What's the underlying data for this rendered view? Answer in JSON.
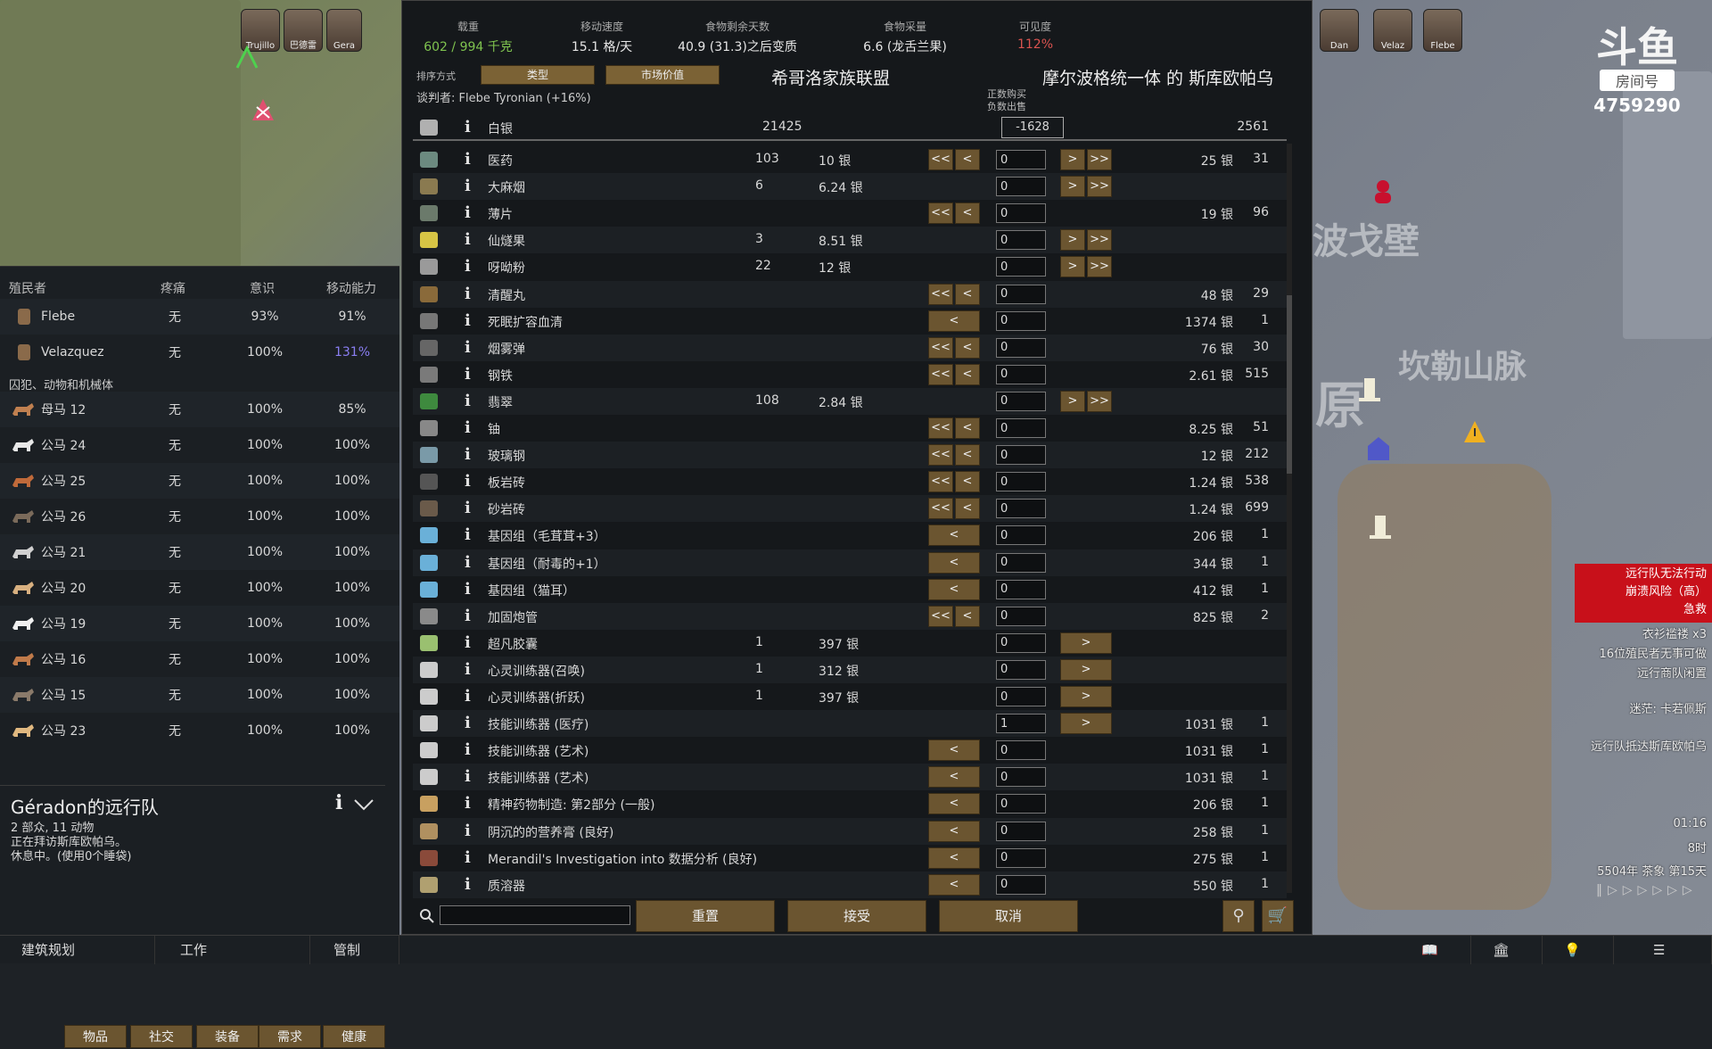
{
  "map": {
    "labels": [
      "波戈壁",
      "坎勒山脉",
      "原"
    ],
    "top_pawns_left": [
      "Trujillo",
      "巴德雷",
      "Gera"
    ],
    "top_pawns_right": [
      "Dan",
      "Velaz",
      "Flebe"
    ],
    "pawn_status": "Z"
  },
  "watermark": {
    "title": "斗鱼",
    "subtitle": "房间号",
    "room": "4759290"
  },
  "trade": {
    "stats": [
      {
        "label": "载重",
        "value": "602 / 994 千克",
        "color": "#7fc34f"
      },
      {
        "label": "移动速度",
        "value": "15.1 格/天",
        "color": "#e6e6e6"
      },
      {
        "label": "食物剩余天数",
        "value": "40.9 (31.3)之后变质",
        "color": "#e6e6e6"
      },
      {
        "label": "食物采量",
        "value": "6.6 (龙舌兰果)",
        "color": "#e6e6e6"
      },
      {
        "label": "可见度",
        "value": "112%",
        "color": "#d9534f"
      }
    ],
    "sort_label": "排序方式",
    "sort_btn1": "类型",
    "sort_btn2": "市场价值",
    "left_faction": "希哥洛家族联盟",
    "negotiator": "谈判者: Flebe Tyronian (+16%)",
    "right_faction": "摩尔波格统一体 的 斯库欧帕乌",
    "buy_sell_hint1": "正数购买",
    "buy_sell_hint2": "负数出售",
    "silver": {
      "name": "白银",
      "qty": "21425",
      "delta": "-1628",
      "trader_qty": "2561"
    },
    "rows": [
      {
        "icon": "#6c8a80",
        "name": "医药",
        "qty": "103",
        "price": "10 银",
        "sell": "25 银",
        "sqty": "31",
        "ll": true,
        "rr": true,
        "val": "0"
      },
      {
        "icon": "#8a7a50",
        "name": "大麻烟",
        "qty": "6",
        "price": "6.24 银",
        "sell": "",
        "sqty": "",
        "ll": false,
        "rr": true,
        "val": "0"
      },
      {
        "icon": "#6b7a6b",
        "name": "薄片",
        "qty": "",
        "price": "",
        "sell": "19 银",
        "sqty": "96",
        "ll": true,
        "rr": false,
        "val": "0"
      },
      {
        "icon": "#d6c445",
        "name": "仙燧果",
        "qty": "3",
        "price": "8.51 银",
        "sell": "",
        "sqty": "",
        "ll": false,
        "rr": true,
        "val": "0"
      },
      {
        "icon": "#9a9a9a",
        "name": "呀呦粉",
        "qty": "22",
        "price": "12 银",
        "sell": "",
        "sqty": "",
        "ll": false,
        "rr": true,
        "val": "0"
      },
      {
        "icon": "#8a6a3a",
        "name": "清醒丸",
        "qty": "",
        "price": "",
        "sell": "48 银",
        "sqty": "29",
        "ll": true,
        "rr": false,
        "val": "0"
      },
      {
        "icon": "#777777",
        "name": "死眠扩容血清",
        "qty": "",
        "price": "",
        "sell": "1374 银",
        "sqty": "1",
        "ll": "single",
        "rr": false,
        "val": "0"
      },
      {
        "icon": "#666666",
        "name": "烟雾弹",
        "qty": "",
        "price": "",
        "sell": "76 银",
        "sqty": "30",
        "ll": true,
        "rr": false,
        "val": "0"
      },
      {
        "icon": "#7a7a7a",
        "name": "钢铁",
        "qty": "",
        "price": "",
        "sell": "2.61 银",
        "sqty": "515",
        "ll": true,
        "rr": false,
        "val": "0"
      },
      {
        "icon": "#3e8a3e",
        "name": "翡翠",
        "qty": "108",
        "price": "2.84 银",
        "sell": "",
        "sqty": "",
        "ll": false,
        "rr": true,
        "val": "0"
      },
      {
        "icon": "#888888",
        "name": "铀",
        "qty": "",
        "price": "",
        "sell": "8.25 银",
        "sqty": "51",
        "ll": true,
        "rr": false,
        "val": "0"
      },
      {
        "icon": "#7a9aa8",
        "name": "玻璃钢",
        "qty": "",
        "price": "",
        "sell": "12 银",
        "sqty": "212",
        "ll": true,
        "rr": false,
        "val": "0"
      },
      {
        "icon": "#555555",
        "name": "板岩砖",
        "qty": "",
        "price": "",
        "sell": "1.24 银",
        "sqty": "538",
        "ll": true,
        "rr": false,
        "val": "0"
      },
      {
        "icon": "#6a5a4a",
        "name": "砂岩砖",
        "qty": "",
        "price": "",
        "sell": "1.24 银",
        "sqty": "699",
        "ll": true,
        "rr": false,
        "val": "0"
      },
      {
        "icon": "#6ab0d8",
        "name": "基因组（毛茸茸+3）",
        "qty": "",
        "price": "",
        "sell": "206 银",
        "sqty": "1",
        "ll": "single",
        "rr": false,
        "val": "0"
      },
      {
        "icon": "#6ab0d8",
        "name": "基因组（耐毒的+1）",
        "qty": "",
        "price": "",
        "sell": "344 银",
        "sqty": "1",
        "ll": "single",
        "rr": false,
        "val": "0"
      },
      {
        "icon": "#6ab0d8",
        "name": "基因组（猫耳）",
        "qty": "",
        "price": "",
        "sell": "412 银",
        "sqty": "1",
        "ll": "single",
        "rr": false,
        "val": "0"
      },
      {
        "icon": "#8a8a8a",
        "name": "加固炮管",
        "qty": "",
        "price": "",
        "sell": "825 银",
        "sqty": "2",
        "ll": true,
        "rr": false,
        "val": "0"
      },
      {
        "icon": "#9ac070",
        "name": "超凡胶囊",
        "qty": "1",
        "price": "397 银",
        "sell": "",
        "sqty": "",
        "ll": false,
        "rr": "single",
        "val": "0"
      },
      {
        "icon": "#cccccc",
        "name": "心灵训练器(召唤)",
        "qty": "1",
        "price": "312 银",
        "sell": "",
        "sqty": "",
        "ll": false,
        "rr": "single",
        "val": "0"
      },
      {
        "icon": "#cccccc",
        "name": "心灵训练器(折跃)",
        "qty": "1",
        "price": "397 银",
        "sell": "",
        "sqty": "",
        "ll": false,
        "rr": "single",
        "val": "0"
      },
      {
        "icon": "#cccccc",
        "name": "技能训练器 (医疗)",
        "qty": "",
        "price": "",
        "sell": "1031 银",
        "sqty": "1",
        "ll": false,
        "rr": "single",
        "val": "1"
      },
      {
        "icon": "#cccccc",
        "name": "技能训练器 (艺术)",
        "qty": "",
        "price": "",
        "sell": "1031 银",
        "sqty": "1",
        "ll": "single",
        "rr": false,
        "val": "0"
      },
      {
        "icon": "#cccccc",
        "name": "技能训练器 (艺术)",
        "qty": "",
        "price": "",
        "sell": "1031 银",
        "sqty": "1",
        "ll": "single",
        "rr": false,
        "val": "0"
      },
      {
        "icon": "#c8a060",
        "name": "精神药物制造: 第2部分 (一般)",
        "qty": "",
        "price": "",
        "sell": "206 银",
        "sqty": "1",
        "ll": "single",
        "rr": false,
        "val": "0"
      },
      {
        "icon": "#b09060",
        "name": "阴沉的的营养膏 (良好)",
        "qty": "",
        "price": "",
        "sell": "258 银",
        "sqty": "1",
        "ll": "single",
        "rr": false,
        "val": "0"
      },
      {
        "icon": "#8a4a3a",
        "name": "Merandil's Investigation into 数据分析 (良好)",
        "qty": "",
        "price": "",
        "sell": "275 银",
        "sqty": "1",
        "ll": "single",
        "rr": false,
        "val": "0"
      },
      {
        "icon": "#b0a070",
        "name": "质溶器",
        "qty": "",
        "price": "",
        "sell": "550 银",
        "sqty": "1",
        "ll": "single",
        "rr": false,
        "val": "0"
      }
    ],
    "search_placeholder": "",
    "btn_reset": "重置",
    "btn_accept": "接受",
    "btn_cancel": "取消"
  },
  "left_panel": {
    "headers": [
      "殖民者",
      "疼痛",
      "意识",
      "移动能力"
    ],
    "colonists": [
      {
        "name": "Flebe",
        "pain": "无",
        "cons": "93%",
        "move": "91%",
        "move_color": "#d8d8d8"
      },
      {
        "name": "Velazquez",
        "pain": "无",
        "cons": "100%",
        "move": "131%",
        "move_color": "#8a7ef2"
      }
    ],
    "section": "囚犯、动物和机械体",
    "animals": [
      {
        "name": "母马 12",
        "pain": "无",
        "cons": "100%",
        "move": "85%",
        "color": "#c08050"
      },
      {
        "name": "公马 24",
        "pain": "无",
        "cons": "100%",
        "move": "100%",
        "color": "#e8e8e8"
      },
      {
        "name": "公马 25",
        "pain": "无",
        "cons": "100%",
        "move": "100%",
        "color": "#c06a3a"
      },
      {
        "name": "公马 26",
        "pain": "无",
        "cons": "100%",
        "move": "100%",
        "color": "#7a6a5a"
      },
      {
        "name": "公马 21",
        "pain": "无",
        "cons": "100%",
        "move": "100%",
        "color": "#d0d0d0"
      },
      {
        "name": "公马 20",
        "pain": "无",
        "cons": "100%",
        "move": "100%",
        "color": "#d8b080"
      },
      {
        "name": "公马 19",
        "pain": "无",
        "cons": "100%",
        "move": "100%",
        "color": "#f0f0f0"
      },
      {
        "name": "公马 16",
        "pain": "无",
        "cons": "100%",
        "move": "100%",
        "color": "#c07a4a"
      },
      {
        "name": "公马 15",
        "pain": "无",
        "cons": "100%",
        "move": "100%",
        "color": "#8a7a6a"
      },
      {
        "name": "公马 23",
        "pain": "无",
        "cons": "100%",
        "move": "100%",
        "color": "#e0b880"
      }
    ],
    "tabs": [
      "物品",
      "社交",
      "装备",
      "需求",
      "健康"
    ]
  },
  "caravan": {
    "title": "Géradon的远行队",
    "line1": "2 部众, 11 动物",
    "line2": "正在拜访斯库欧帕乌。",
    "line3": "休息中。(使用0个睡袋)"
  },
  "bottom_bar": [
    "建筑规划",
    "工作",
    "管制"
  ],
  "right": {
    "alert": [
      "远行队无法行动",
      "崩溃风险（高）",
      "急救"
    ],
    "messages": [
      "衣衫褴褛 x3",
      "16位殖民者无事可做",
      "远行商队闲置"
    ],
    "labels": [
      "迷茫: 卡若佩斯",
      "远行队抵达斯库欧帕乌"
    ],
    "time": "01:16",
    "hour": "8时",
    "date": "5504年 茶象 第15天"
  }
}
